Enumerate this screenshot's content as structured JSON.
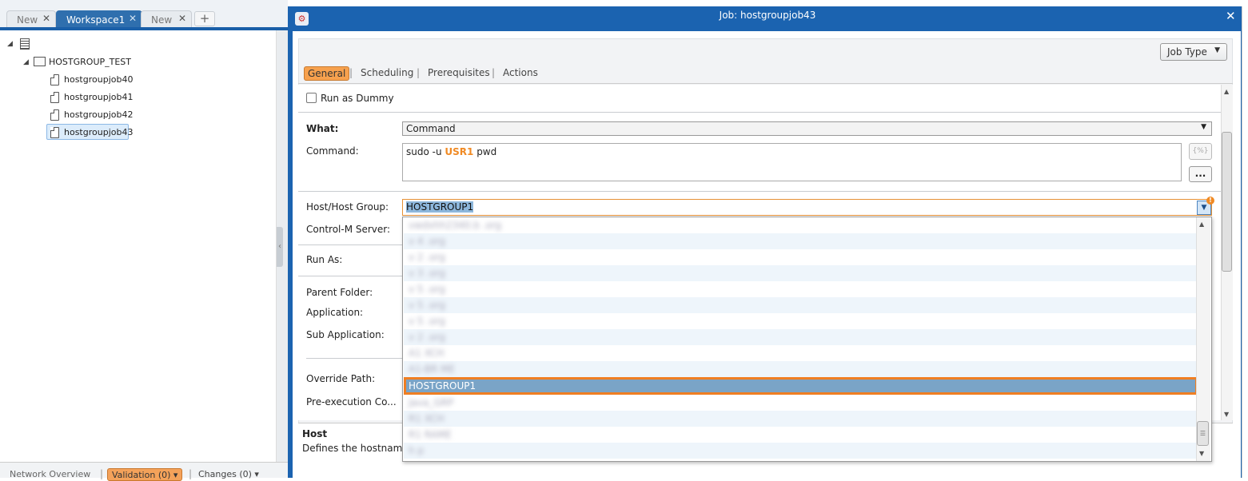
{
  "tabs": [
    {
      "label": "New",
      "active": false
    },
    {
      "label": "Workspace1",
      "active": true
    },
    {
      "label": "New",
      "active": false
    }
  ],
  "add_tab_icon": "plus-icon",
  "tree": {
    "folder": "HOSTGROUP_TEST",
    "jobs": [
      "hostgroupjob40",
      "hostgroupjob41",
      "hostgroupjob42",
      "hostgroupjob43"
    ],
    "selected": "hostgroupjob43"
  },
  "bottom": {
    "network": "Network Overview",
    "validation": "Validation (0)",
    "changes": "Changes (0)"
  },
  "dialog": {
    "title": "Job: hostgroupjob43",
    "job_type_label": "Job Type",
    "subtabs": [
      "General",
      "Scheduling",
      "Prerequisites",
      "Actions"
    ],
    "active_subtab": "General",
    "run_as_dummy": "Run as Dummy",
    "labels": {
      "what": "What:",
      "command": "Command:",
      "host": "Host/Host Group:",
      "server": "Control-M Server:",
      "run_as": "Run As:",
      "parent_folder": "Parent Folder:",
      "application": "Application:",
      "sub_application": "Sub Application:",
      "override_path": "Override Path:",
      "pre_exec": "Pre-execution Co..."
    },
    "what_value": "Command",
    "command": {
      "prefix": "sudo -u ",
      "variable": "USR1",
      "suffix": " pwd"
    },
    "variable_button": "{%}",
    "dots_button": "...",
    "host_value": "HOSTGROUP1",
    "help_title": "Host",
    "help_text": "Defines the hostname"
  },
  "dropdown": {
    "options": [
      {
        "text": "vwdxhh2340.b          .org",
        "blurred": true
      },
      {
        "text": "v          4                .org",
        "blurred": true
      },
      {
        "text": "v          2                    .org",
        "blurred": true
      },
      {
        "text": "v          3                .org",
        "blurred": true
      },
      {
        "text": "v          5                .org",
        "blurred": true
      },
      {
        "text": "v          5                .org",
        "blurred": true
      },
      {
        "text": "v          5                .org",
        "blurred": true
      },
      {
        "text": "v          2                    .org",
        "blurred": true
      },
      {
        "text": "A1          XCH",
        "blurred": true
      },
      {
        "text": "A1-BR          ME",
        "blurred": true
      },
      {
        "text": "HOSTGROUP1",
        "blurred": false,
        "selected": true
      },
      {
        "text": "Java_GRP",
        "blurred": true
      },
      {
        "text": "R1          XCH",
        "blurred": true
      },
      {
        "text": "R1          RAME",
        "blurred": true
      },
      {
        "text": "h          p",
        "blurred": true
      }
    ]
  },
  "colors": {
    "accent": "#1b63b0",
    "selection_outline": "#ef7e22",
    "active_subtab": "#f7a14e"
  }
}
